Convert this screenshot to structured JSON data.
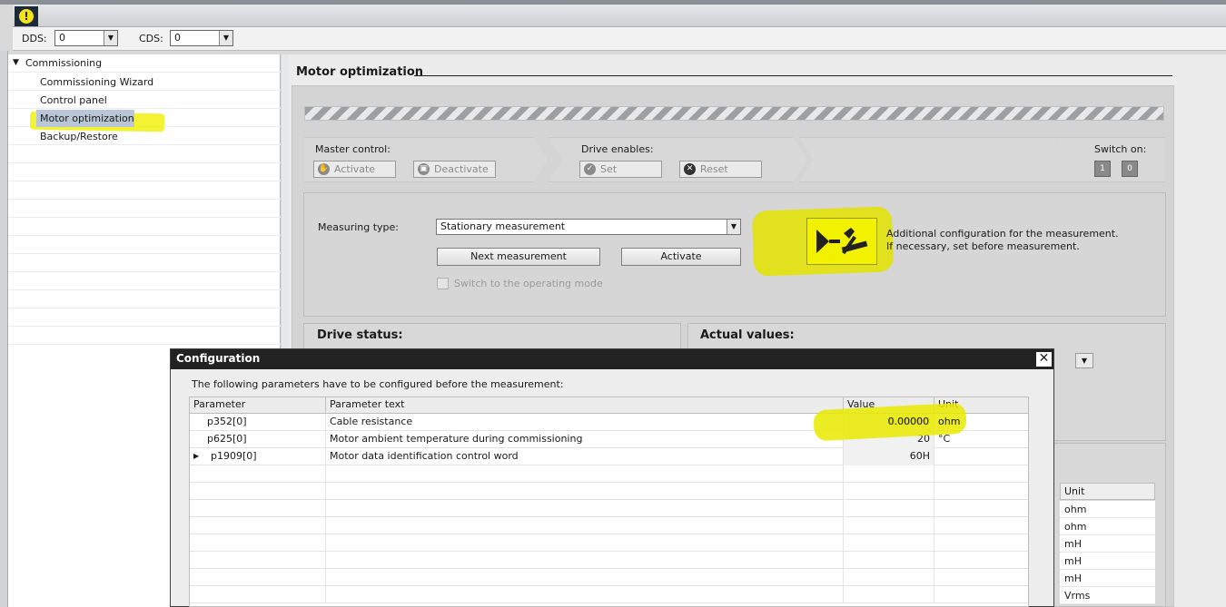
{
  "toolbar": {
    "warning_icon": "warning-icon",
    "dds_label": "DDS:",
    "dds_value": "0",
    "cds_label": "CDS:",
    "cds_value": "0"
  },
  "tree": {
    "root": "Commissioning",
    "items": [
      "Commissioning Wizard",
      "Control panel",
      "Motor optimization",
      "Backup/Restore"
    ],
    "selected": "Motor optimization"
  },
  "motor_optimization": {
    "title": "Motor optimization",
    "master_control": {
      "label": "Master control:",
      "activate": "Activate",
      "deactivate": "Deactivate"
    },
    "drive_enables": {
      "label": "Drive enables:",
      "set": "Set",
      "reset": "Reset"
    },
    "switch_on": {
      "label": "Switch on:",
      "on": "1",
      "off": "0"
    },
    "measuring_type_label": "Measuring type:",
    "measuring_type_value": "Stationary measurement",
    "next_measurement": "Next measurement",
    "activate": "Activate",
    "switch_operating_mode": "Switch to the operating mode",
    "config_note_line1": "Additional configuration for the measurement.",
    "config_note_line2": "If necessary, set before measurement.",
    "drive_status": "Drive status:",
    "actual_values": "Actual values:",
    "units_header": "Unit",
    "units": [
      "ohm",
      "ohm",
      "mH",
      "mH",
      "mH",
      "Vrms"
    ]
  },
  "dialog": {
    "title": "Configuration",
    "message": "The following parameters have to be configured before the measurement:",
    "columns": [
      "Parameter",
      "Parameter text",
      "Value",
      "Unit"
    ],
    "rows": [
      {
        "param": "p352[0]",
        "text": "Cable resistance",
        "value": "0.00000",
        "unit": "ohm"
      },
      {
        "param": "p625[0]",
        "text": "Motor ambient temperature during commissioning",
        "value": "20",
        "unit": "°C"
      },
      {
        "param": "p1909[0]",
        "text": "Motor data identification control word",
        "value": "60H",
        "unit": ""
      }
    ]
  },
  "colors": {
    "highlight": "#f0f000",
    "dialog_title": "#222222"
  }
}
